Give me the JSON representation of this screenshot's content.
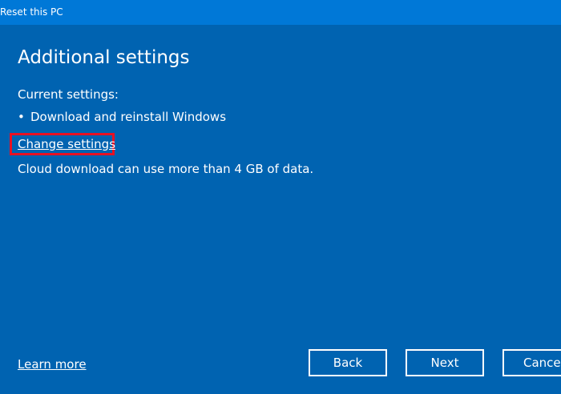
{
  "window": {
    "title": "Reset this PC"
  },
  "page": {
    "heading": "Additional settings",
    "current_settings_label": "Current settings:",
    "bullet_glyph": "•",
    "current_settings_items": [
      "Download and reinstall Windows"
    ],
    "change_settings_link": "Change settings",
    "cloud_note": "Cloud download can use more than 4 GB of data."
  },
  "footer": {
    "learn_more_link": "Learn more",
    "back_label": "Back",
    "next_label": "Next",
    "cancel_label": "Cancel"
  },
  "colors": {
    "background": "#0063b1",
    "titlebar": "#0078d7",
    "text": "#ffffff",
    "highlight_outline": "#e81123"
  }
}
